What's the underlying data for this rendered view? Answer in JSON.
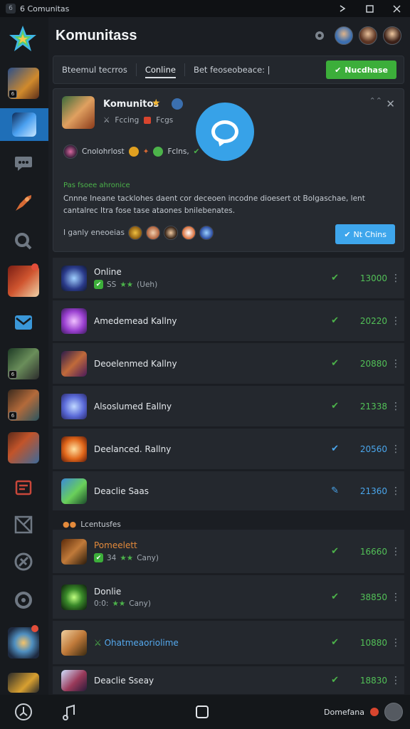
{
  "window": {
    "title": "6 Comunitas",
    "controls": [
      "pin-icon",
      "maximize-icon",
      "close-icon"
    ]
  },
  "header": {
    "title": "Komunitass"
  },
  "tabs": [
    {
      "label": "Bteemul tecrros"
    },
    {
      "label": "Conline"
    },
    {
      "label": "Bet feoseobeace: |"
    }
  ],
  "top_action": {
    "label": "Nucdhase"
  },
  "community": {
    "name": "Komunitos",
    "meta_a": "Fccing",
    "meta_b": "Fcgs",
    "row_label": "Cnolohrlost",
    "row_tag": "Fclns,",
    "section_title": "Pas fsoee ahronice",
    "description": "Cnnne Ineane tacklohes daent cor deceoen incodne dioesert ot Bolgaschae, lent cantalrec Itra fose tase ataones bnilebenates.",
    "members_label": "I ganly eneoeias",
    "join_label": "Nt Chins"
  },
  "rows": [
    {
      "name": "Online",
      "sub": "SS",
      "sub_tail": "(Ueh)",
      "value": "13000"
    },
    {
      "name": "Amedemead Kallny",
      "value": "20220"
    },
    {
      "name": "Deoelenmed Kallny",
      "value": "20880"
    },
    {
      "name": "Alsoslumed Eallny",
      "value": "21338"
    },
    {
      "name": "Deelanced. Rallny",
      "value": "20560"
    },
    {
      "name": "Deaclie Saas",
      "value": "21360"
    }
  ],
  "section2": {
    "label": "Lcentusfes"
  },
  "rows2": [
    {
      "name": "Pomeelett",
      "sub": "34",
      "sub_tail": "Cany)",
      "value": "16660"
    },
    {
      "name": "Donlie",
      "sub": "0:0:",
      "sub_tail": "Cany)",
      "value": "38850"
    },
    {
      "name": "Ohatmeaoriolime",
      "value": "10880"
    },
    {
      "name": "Deaclie Sseay",
      "value": "18830"
    }
  ],
  "bottom": {
    "label": "Domefana"
  },
  "colors": {
    "accent_green": "#3cae3a",
    "accent_blue": "#3ea6ec",
    "sidebar_active": "#1f6fb8"
  }
}
